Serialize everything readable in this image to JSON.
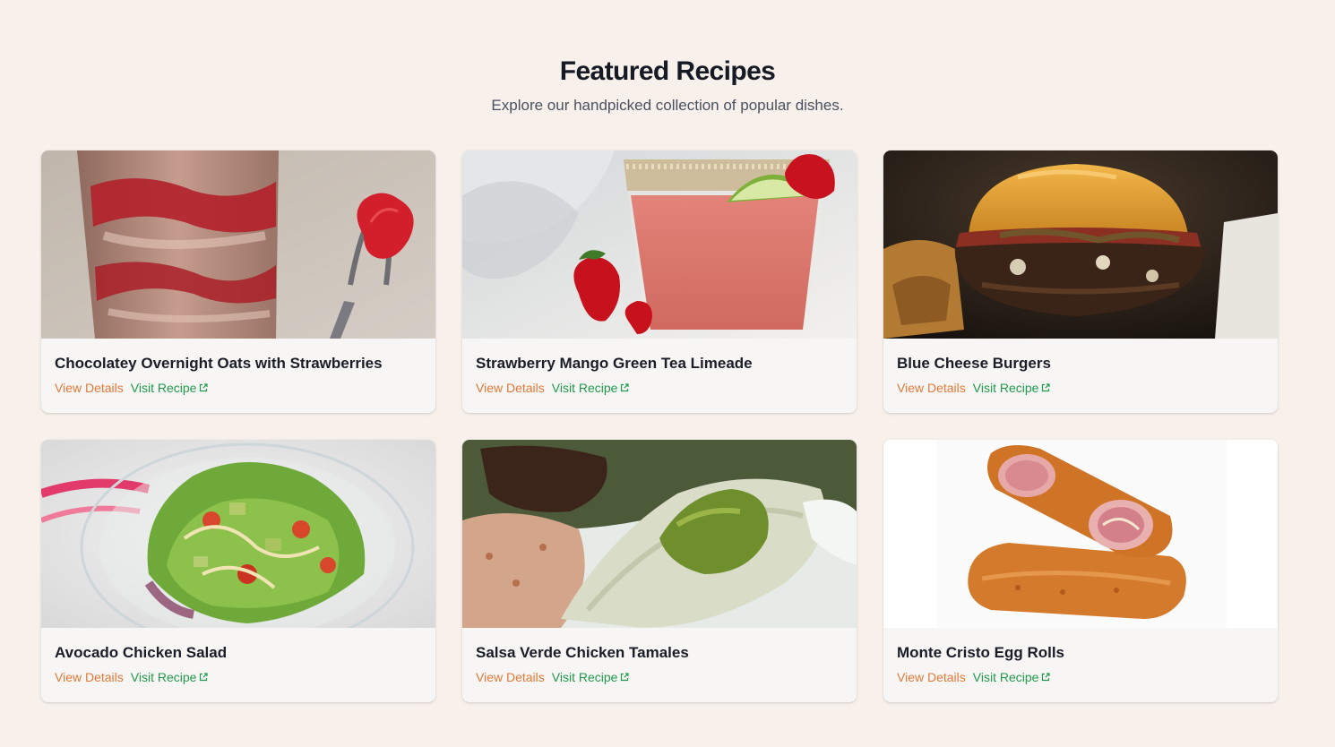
{
  "header": {
    "title": "Featured Recipes",
    "subtitle": "Explore our handpicked collection of popular dishes."
  },
  "colors": {
    "background": "#f7f0eb",
    "card_background": "#f8f6f4",
    "view_details": "#e2793a",
    "visit_recipe": "#1f9a4e",
    "title": "#161a25"
  },
  "recipes": [
    {
      "title": "Chocolatey Overnight Oats with Strawberries",
      "image": "overnight-oats-jar-photo",
      "view_label": "View Details",
      "visit_label": "Visit Recipe",
      "visit_icon": "external-link-icon"
    },
    {
      "title": "Strawberry Mango Green Tea Limeade",
      "image": "limeade-glass-photo",
      "view_label": "View Details",
      "visit_label": "Visit Recipe",
      "visit_icon": "external-link-icon"
    },
    {
      "title": "Blue Cheese Burgers",
      "image": "burger-photo",
      "view_label": "View Details",
      "visit_label": "Visit Recipe",
      "visit_icon": "external-link-icon"
    },
    {
      "title": "Avocado Chicken Salad",
      "image": "salad-bowl-photo",
      "view_label": "View Details",
      "visit_label": "Visit Recipe",
      "visit_icon": "external-link-icon"
    },
    {
      "title": "Salsa Verde Chicken Tamales",
      "image": "tamales-plate-photo",
      "view_label": "View Details",
      "visit_label": "Visit Recipe",
      "visit_icon": "external-link-icon"
    },
    {
      "title": "Monte Cristo Egg Rolls",
      "image": "egg-rolls-photo",
      "view_label": "View Details",
      "visit_label": "Visit Recipe",
      "visit_icon": "external-link-icon"
    }
  ]
}
